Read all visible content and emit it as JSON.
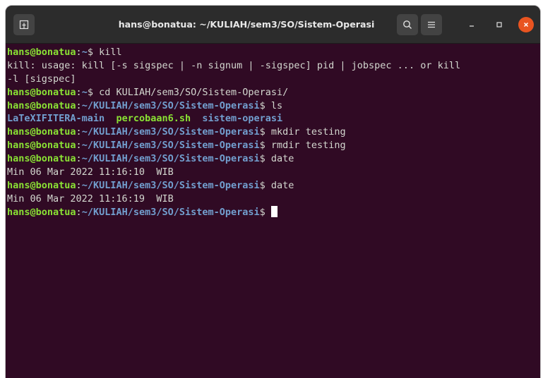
{
  "window": {
    "title": "hans@bonatua: ~/KULIAH/sem3/SO/Sistem-Operasi"
  },
  "icons": {
    "new_tab": "new-tab-icon",
    "search": "search-icon",
    "menu": "hamburger-menu-icon",
    "minimize": "minimize-icon",
    "maximize": "maximize-icon",
    "close": "close-icon"
  },
  "colors": {
    "terminal_bg": "#300a24",
    "titlebar_bg": "#2c2c2c",
    "prompt_user": "#8ae234",
    "prompt_path": "#729fcf",
    "text": "#d3d7cf",
    "close_button": "#e95420"
  },
  "terminal": {
    "prompt_user": "hans@bonatua",
    "prompt_sep": ":",
    "lines": {
      "l1": {
        "path": "~",
        "dollar": "$ ",
        "cmd": "kill"
      },
      "l2": {
        "text": "kill: usage: kill [-s sigspec | -n signum | -sigspec] pid | jobspec ... or kill"
      },
      "l3": {
        "text": "-l [sigspec]"
      },
      "l4": {
        "path": "~",
        "dollar": "$ ",
        "cmd": "cd KULIAH/sem3/SO/Sistem-Operasi/"
      },
      "l5": {
        "path": "~/KULIAH/sem3/SO/Sistem-Operasi",
        "dollar": "$ ",
        "cmd": "ls"
      },
      "l6": {
        "entry1": "LaTeXIFITERA-main",
        "entry2": "percobaan6.sh",
        "entry3": "sistem-operasi"
      },
      "l7": {
        "path": "~/KULIAH/sem3/SO/Sistem-Operasi",
        "dollar": "$ ",
        "cmd": "mkdir testing"
      },
      "l8": {
        "path": "~/KULIAH/sem3/SO/Sistem-Operasi",
        "dollar": "$ ",
        "cmd": "rmdir testing"
      },
      "l9": {
        "path": "~/KULIAH/sem3/SO/Sistem-Operasi",
        "dollar": "$ ",
        "cmd": "date"
      },
      "l10": {
        "text": "Min 06 Mar 2022 11:16:10  WIB"
      },
      "l11": {
        "path": "~/KULIAH/sem3/SO/Sistem-Operasi",
        "dollar": "$ ",
        "cmd": "date"
      },
      "l12": {
        "text": "Min 06 Mar 2022 11:16:19  WIB"
      },
      "l13": {
        "path": "~/KULIAH/sem3/SO/Sistem-Operasi",
        "dollar": "$ ",
        "cmd": ""
      }
    }
  }
}
